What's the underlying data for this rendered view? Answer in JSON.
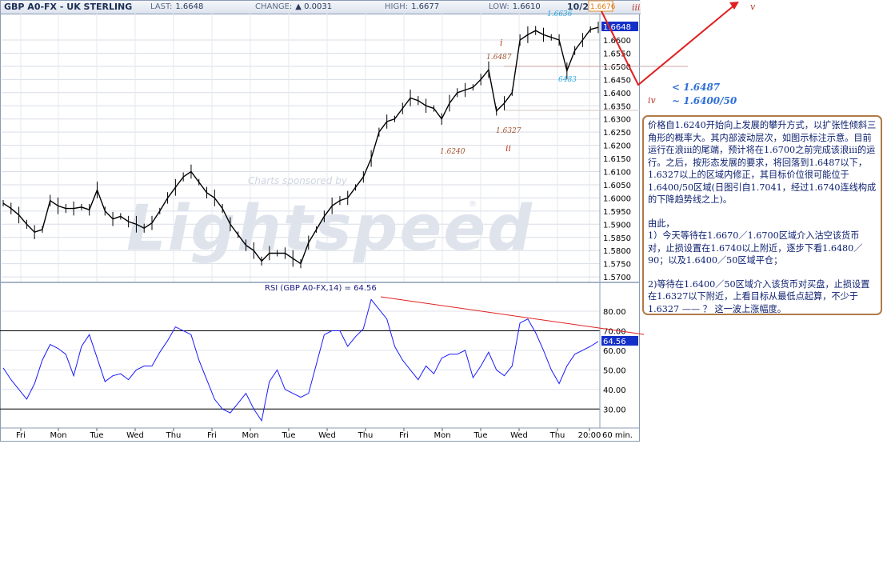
{
  "header": {
    "symbol_title": "GBP A0-FX - UK STERLING",
    "last_label": "LAST:",
    "last_value": "1.6648",
    "change_label": "CHANGE:",
    "change_value": "▲ 0.0031",
    "high_label": "HIGH:",
    "high_value": "1.6677",
    "low_label": "LOW:",
    "low_value": "1.6610",
    "date": "10/23"
  },
  "price_tags": {
    "high_tag": "1.6676",
    "last_tag": "1.6648"
  },
  "sponsor": {
    "text": "Charts sponsored by",
    "logo": "Lightspeed",
    "mark": "®"
  },
  "rsi_panel": {
    "title": "RSI (GBP A0-FX,14) = 64.56",
    "current_value": "64.56"
  },
  "interval": "60 min.",
  "colors": {
    "price_line": "#000000",
    "rsi_line": "#1a1aff",
    "annotation_red": "#e02020",
    "wave_label_red": "#c0392b",
    "price_label_blue": "#2aa8e0",
    "annotation_blue": "#2f6fd6"
  },
  "wave_labels": [
    {
      "text": "i",
      "style": "red-italic"
    },
    {
      "text": "ii",
      "style": "red-italic"
    },
    {
      "text": "iii",
      "style": "red-italic"
    },
    {
      "text": "iv",
      "style": "red-italic"
    },
    {
      "text": "v",
      "style": "red-italic"
    }
  ],
  "price_labels": [
    {
      "text": "1.6487",
      "color": "brown"
    },
    {
      "text": "1.6327",
      "color": "brown"
    },
    {
      "text": "1.6240",
      "color": "brown"
    },
    {
      "text": "1.6636",
      "color": "blue"
    },
    {
      "text": "6483",
      "color": "blue"
    }
  ],
  "targets": {
    "first": "< 1.6487",
    "second": "~ 1.6400/50"
  },
  "annotation": {
    "para1": "价格自1.6240开始向上发展的攀升方式，以扩张性倾斜三角形的概率大。其内部波动层次，如图示标注示意。目前运行在浪iii的尾端，预计将在1.6700之前完成该浪iii的运行。之后，按形态发展的要求，将回落到1.6487以下，1.6327以上的区域内修正，其目标价位很可能位于1.6400/50区域(日图引自1.7041，经过1.6740连线构成的下降趋势线之上)。",
    "para2_title": "由此，",
    "para2": "1）今天等待在1.6670／1.6700区域介入沽空该货币对，止损设置在1.6740以上附近，逐步下看1.6480／90；以及1.6400／50区域平仓；",
    "para3": "2)等待在1.6400／50区域介入该货币对买盘，止损设置在1.6327以下附近，上看目标从最低点起算，不少于1.6327 —— ？ 这一波上涨幅度。"
  },
  "chart_data": [
    {
      "type": "line",
      "title": "GBP A0-FX - UK STERLING",
      "interval": "60 min.",
      "x_tick_labels": [
        "Fri",
        "Mon",
        "Tue",
        "Wed",
        "Thu",
        "Fri",
        "Mon",
        "Tue",
        "Wed",
        "Thu",
        "Fri",
        "Mon",
        "Tue",
        "Wed",
        "Thu",
        "20:00"
      ],
      "y_tick_labels": [
        "1.6600",
        "1.6550",
        "1.6500",
        "1.6450",
        "1.6400",
        "1.6350",
        "1.6300",
        "1.6250",
        "1.6200",
        "1.6150",
        "1.6100",
        "1.6050",
        "1.6000",
        "1.5950",
        "1.5900",
        "1.5850",
        "1.5800",
        "1.5750",
        "1.5700"
      ],
      "ylim": [
        1.57,
        1.669
      ],
      "grid": true,
      "series": [
        {
          "x": [
            0,
            1,
            2,
            3,
            4,
            5,
            6,
            7,
            8,
            9,
            10,
            11,
            12,
            13,
            14,
            15,
            16,
            17,
            18,
            19,
            20,
            21,
            22,
            23,
            24,
            25,
            26,
            27,
            28,
            29,
            30,
            31,
            32,
            33,
            34,
            35,
            36,
            37,
            38,
            39,
            40,
            41,
            42,
            43,
            44,
            45,
            46,
            47,
            48,
            49,
            50,
            51,
            52,
            53,
            54,
            55,
            56,
            57,
            58,
            59,
            60,
            61,
            62,
            63,
            64,
            65,
            66,
            67,
            68,
            69,
            70,
            71,
            72,
            73,
            74,
            75,
            76
          ],
          "values": [
            1.598,
            1.596,
            1.5935,
            1.59,
            1.587,
            1.588,
            1.599,
            1.597,
            1.596,
            1.596,
            1.5965,
            1.5955,
            1.603,
            1.595,
            1.592,
            1.593,
            1.591,
            1.59,
            1.5885,
            1.5905,
            1.595,
            1.6,
            1.604,
            1.608,
            1.61,
            1.606,
            1.602,
            1.6,
            1.596,
            1.59,
            1.586,
            1.582,
            1.58,
            1.576,
            1.579,
            1.579,
            1.579,
            1.577,
            1.575,
            1.583,
            1.588,
            1.593,
            1.597,
            1.599,
            1.6,
            1.604,
            1.608,
            1.615,
            1.625,
            1.629,
            1.63,
            1.634,
            1.638,
            1.637,
            1.635,
            1.634,
            1.63,
            1.636,
            1.64,
            1.641,
            1.642,
            1.645,
            1.6487,
            1.633,
            1.636,
            1.64,
            1.66,
            1.662,
            1.6636,
            1.662,
            1.661,
            1.66,
            1.6483,
            1.656,
            1.66,
            1.664,
            1.6648
          ]
        }
      ]
    },
    {
      "type": "line",
      "title": "RSI (GBP A0-FX,14) = 64.56",
      "y_tick_labels": [
        "80.00",
        "70.00",
        "60.00",
        "50.00",
        "40.00",
        "30.00"
      ],
      "ylim": [
        22,
        88
      ],
      "reference_lines": [
        70,
        30
      ],
      "series": [
        {
          "x": [
            0,
            1,
            2,
            3,
            4,
            5,
            6,
            7,
            8,
            9,
            10,
            11,
            12,
            13,
            14,
            15,
            16,
            17,
            18,
            19,
            20,
            21,
            22,
            23,
            24,
            25,
            26,
            27,
            28,
            29,
            30,
            31,
            32,
            33,
            34,
            35,
            36,
            37,
            38,
            39,
            40,
            41,
            42,
            43,
            44,
            45,
            46,
            47,
            48,
            49,
            50,
            51,
            52,
            53,
            54,
            55,
            56,
            57,
            58,
            59,
            60,
            61,
            62,
            63,
            64,
            65,
            66,
            67,
            68,
            69,
            70,
            71,
            72,
            73,
            74,
            75,
            76
          ],
          "values": [
            51,
            45,
            40,
            35,
            43,
            55,
            63,
            61,
            58,
            47,
            62,
            68,
            56,
            44,
            47,
            48,
            45,
            50,
            52,
            52,
            59,
            65,
            72,
            70,
            68,
            55,
            45,
            35,
            30,
            28,
            33,
            38,
            30,
            24,
            44,
            50,
            40,
            38,
            36,
            38,
            53,
            68,
            70,
            70,
            62,
            67,
            71,
            86,
            81,
            76,
            62,
            55,
            50,
            45,
            52,
            48,
            56,
            58,
            58,
            60,
            46,
            52,
            59,
            50,
            47,
            52,
            74,
            76,
            69,
            60,
            50,
            43,
            52,
            58,
            60,
            62,
            64.56
          ]
        }
      ]
    }
  ]
}
